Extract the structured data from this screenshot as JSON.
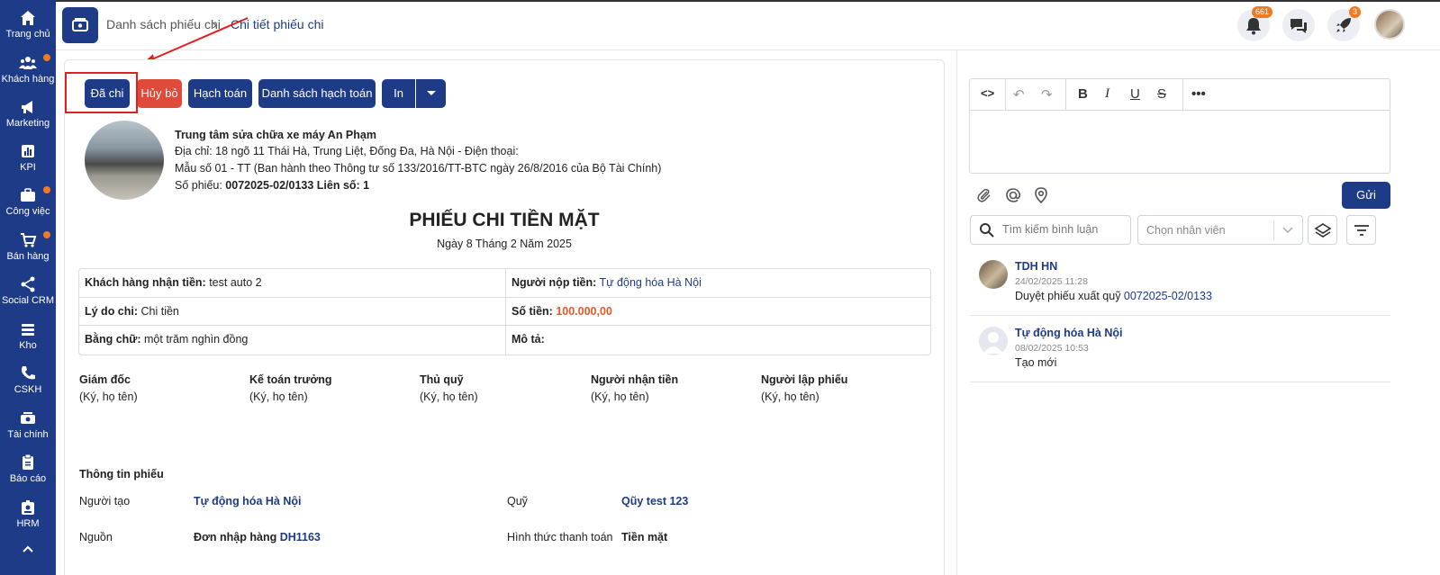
{
  "sidebar": {
    "items": [
      {
        "label": "Trang chủ",
        "icon": "home-icon"
      },
      {
        "label": "Khách hàng",
        "icon": "users-icon",
        "dot": true
      },
      {
        "label": "Marketing",
        "icon": "megaphone-icon"
      },
      {
        "label": "KPI",
        "icon": "chart-icon"
      },
      {
        "label": "Công việc",
        "icon": "briefcase-icon",
        "dot": true
      },
      {
        "label": "Bán hàng",
        "icon": "cart-icon",
        "dot": true
      },
      {
        "label": "Social CRM",
        "icon": "share-icon"
      },
      {
        "label": "Kho",
        "icon": "stack-icon"
      },
      {
        "label": "CSKH",
        "icon": "phone-icon"
      },
      {
        "label": "Tài chính",
        "icon": "cash-icon"
      },
      {
        "label": "Báo cáo",
        "icon": "clipboard-icon"
      },
      {
        "label": "HRM",
        "icon": "id-card-icon"
      }
    ]
  },
  "breadcrumb": {
    "parent": "Danh sách phiếu chi",
    "separator": "›",
    "current": "Chi tiết phiếu chi"
  },
  "header": {
    "notification_count": "661",
    "rocket_count": "3"
  },
  "actions": {
    "paid": "Đã chi",
    "cancel": "Hủy bỏ",
    "accounting": "Hạch toán",
    "accounting_list": "Danh sách hạch toán",
    "print": "In"
  },
  "company": {
    "name": "Trung tâm sửa chữa xe máy An Phạm",
    "address": "Địa chỉ: 18 ngõ 11 Thái Hà, Trung Liệt, Đống Đa, Hà Nội - Điện thoại:",
    "form": "Mẫu số 01 - TT (Ban hành theo Thông tư số 133/2016/TT-BTC ngày 26/8/2016 của Bộ Tài Chính)",
    "number_label": "Số phiếu: ",
    "number_value": "0072025-02/0133 Liên số: 1"
  },
  "voucher": {
    "title": "PHIẾU CHI TIỀN MẶT",
    "date": "Ngày 8 Tháng 2 Năm 2025",
    "rows": [
      {
        "l_label": "Khách hàng nhận tiền:",
        "l_value": " test auto 2",
        "r_label": "Người nộp tiền:",
        "r_value": " Tự động hóa Hà Nội"
      },
      {
        "l_label": "Lý do chi:",
        "l_value": " Chi tiền",
        "r_label": "Số tiền:",
        "r_value": " 100.000,00"
      },
      {
        "l_label": "Bằng chữ:",
        "l_value": " một trăm nghìn đồng",
        "r_label": "Mô tả:",
        "r_value": ""
      }
    ]
  },
  "signatures": [
    {
      "role": "Giám đốc",
      "note": "(Ký, họ tên)"
    },
    {
      "role": "Kế toán trưởng",
      "note": "(Ký, họ tên)"
    },
    {
      "role": "Thủ quỹ",
      "note": "(Ký, họ tên)"
    },
    {
      "role": "Người nhận tiền",
      "note": "(Ký, họ tên)"
    },
    {
      "role": "Người lập phiếu",
      "note": "(Ký, họ tên)"
    }
  ],
  "info": {
    "section_title": "Thông tin phiếu",
    "creator_label": "Người tạo",
    "creator_value": "Tự động hóa Hà Nội",
    "fund_label": "Quỹ",
    "fund_value": "Qũy test 123",
    "source_label": "Nguồn",
    "source_value": "Đơn nhập hàng",
    "source_code": "DH1163",
    "payment_label": "Hình thức thanh toán",
    "payment_value": "Tiền mặt"
  },
  "comments_panel": {
    "send": "Gửi",
    "search_placeholder": "Tìm kiếm bình luận",
    "employee_placeholder": "Chọn nhân viên",
    "items": [
      {
        "name": "TDH HN",
        "time": "24/02/2025 11:28",
        "text": "Duyệt phiếu xuất quỹ ",
        "link": "0072025-02/0133"
      },
      {
        "name": "Tự động hóa Hà Nội",
        "time": "08/02/2025 10:53",
        "text": "Tạo mới",
        "link": ""
      }
    ]
  },
  "colors": {
    "primary": "#1d3b86",
    "danger": "#e04a3a",
    "accent": "#f07a22",
    "amount": "#e05a25"
  }
}
